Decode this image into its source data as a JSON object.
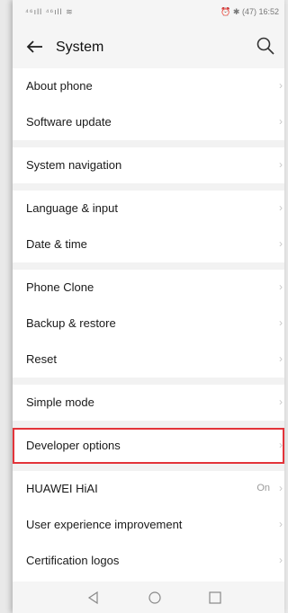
{
  "status": {
    "left": "⁴⁶ıll ⁴⁶ıll ≋",
    "right": "⏰ ✱ (47) 16:52"
  },
  "header": {
    "title": "System"
  },
  "groups": [
    [
      {
        "label": "About phone"
      },
      {
        "label": "Software update"
      }
    ],
    [
      {
        "label": "System navigation"
      }
    ],
    [
      {
        "label": "Language & input"
      },
      {
        "label": "Date & time"
      }
    ],
    [
      {
        "label": "Phone Clone"
      },
      {
        "label": "Backup & restore"
      },
      {
        "label": "Reset"
      }
    ],
    [
      {
        "label": "Simple mode"
      }
    ],
    [
      {
        "label": "Developer options"
      }
    ],
    [
      {
        "label": "HUAWEI HiAI",
        "value": "On"
      },
      {
        "label": "User experience improvement"
      },
      {
        "label": "Certification logos"
      }
    ]
  ],
  "chevron": "›",
  "selected": "Developer options",
  "icons": {
    "back": "back-arrow-icon",
    "search": "search-icon",
    "nav_back": "nav-back-icon",
    "nav_home": "nav-home-icon",
    "nav_recent": "nav-recent-icon"
  },
  "colors": {
    "highlight": "#e3343a"
  }
}
